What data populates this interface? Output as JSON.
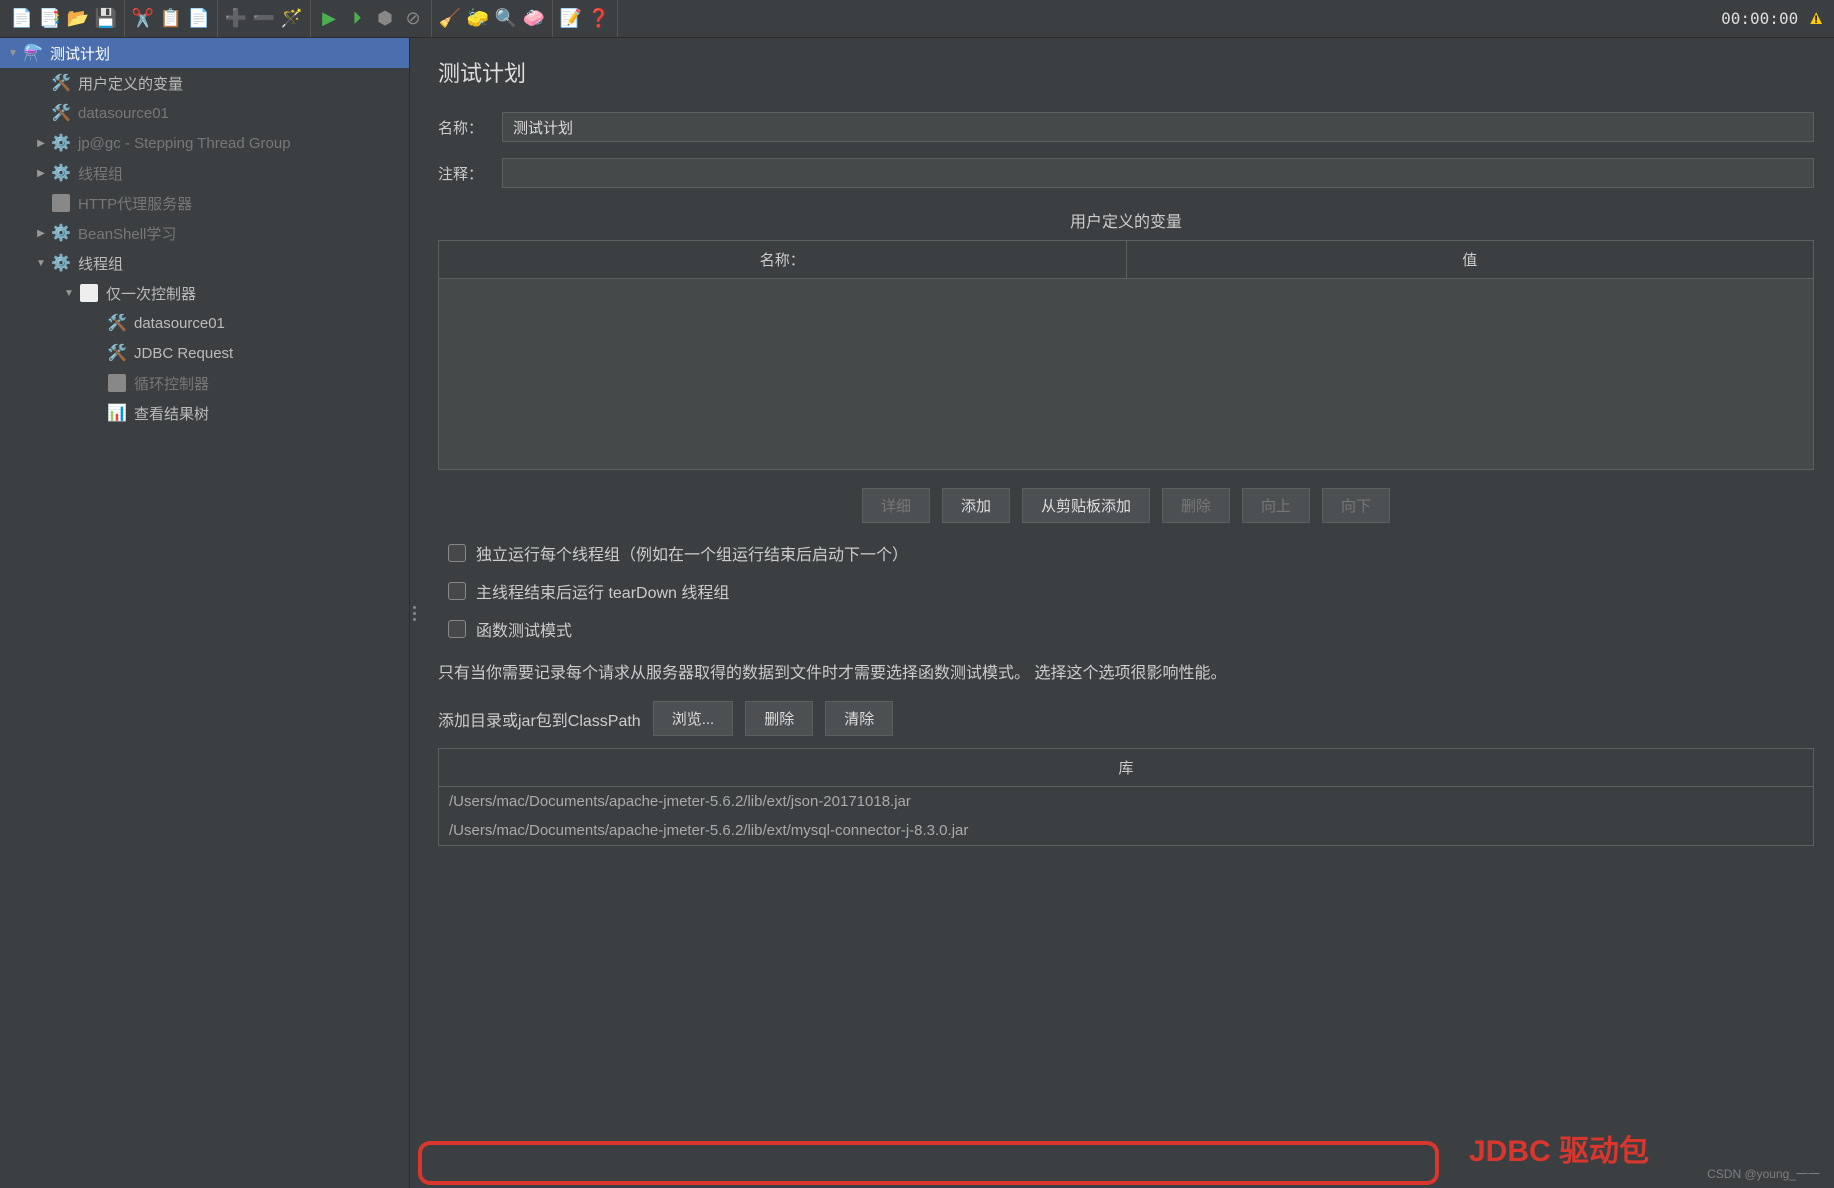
{
  "toolbar": {
    "timer": "00:00:00"
  },
  "tree": {
    "items": [
      {
        "label": "测试计划",
        "indent": 0,
        "arrow": "down",
        "icon": "flask",
        "selected": true
      },
      {
        "label": "用户定义的变量",
        "indent": 1,
        "arrow": "none",
        "icon": "wrench"
      },
      {
        "label": "datasource01",
        "indent": 1,
        "arrow": "none",
        "icon": "wrench",
        "dim": true
      },
      {
        "label": "jp@gc - Stepping Thread Group",
        "indent": 1,
        "arrow": "right",
        "icon": "gear",
        "dim": true
      },
      {
        "label": "线程组",
        "indent": 1,
        "arrow": "right",
        "icon": "gear",
        "dim": true
      },
      {
        "label": "HTTP代理服务器",
        "indent": 1,
        "arrow": "none",
        "icon": "box",
        "dim": true
      },
      {
        "label": "BeanShell学习",
        "indent": 1,
        "arrow": "right",
        "icon": "gear",
        "dim": true
      },
      {
        "label": "线程组",
        "indent": 1,
        "arrow": "down",
        "icon": "gear"
      },
      {
        "label": "仅一次控制器",
        "indent": 2,
        "arrow": "down",
        "icon": "white"
      },
      {
        "label": "datasource01",
        "indent": 3,
        "arrow": "none",
        "icon": "wrench"
      },
      {
        "label": "JDBC Request",
        "indent": 3,
        "arrow": "none",
        "icon": "wrench"
      },
      {
        "label": "循环控制器",
        "indent": 3,
        "arrow": "none",
        "icon": "box",
        "dim": true
      },
      {
        "label": "查看结果树",
        "indent": 3,
        "arrow": "none",
        "icon": "tree-result"
      }
    ]
  },
  "panel": {
    "title": "测试计划",
    "name_label": "名称：",
    "name_value": "测试计划",
    "comment_label": "注释：",
    "vars_section": "用户定义的变量",
    "col_name": "名称：",
    "col_value": "值",
    "btn_detail": "详细",
    "btn_add": "添加",
    "btn_paste": "从剪贴板添加",
    "btn_delete": "删除",
    "btn_up": "向上",
    "btn_down": "向下",
    "chk1": "独立运行每个线程组（例如在一个组运行结束后启动下一个）",
    "chk2": "主线程结束后运行 tearDown 线程组",
    "chk3": "函数测试模式",
    "note": "只有当你需要记录每个请求从服务器取得的数据到文件时才需要选择函数测试模式。 选择这个选项很影响性能。",
    "classpath_label": "添加目录或jar包到ClassPath",
    "btn_browse": "浏览...",
    "btn_del2": "删除",
    "btn_clear": "清除",
    "lib_header": "库",
    "libs": [
      "/Users/mac/Documents/apache-jmeter-5.6.2/lib/ext/json-20171018.jar",
      "/Users/mac/Documents/apache-jmeter-5.6.2/lib/ext/mysql-connector-j-8.3.0.jar"
    ]
  },
  "annotation": {
    "text": "JDBC 驱动包"
  },
  "watermark": "CSDN @young_一一"
}
